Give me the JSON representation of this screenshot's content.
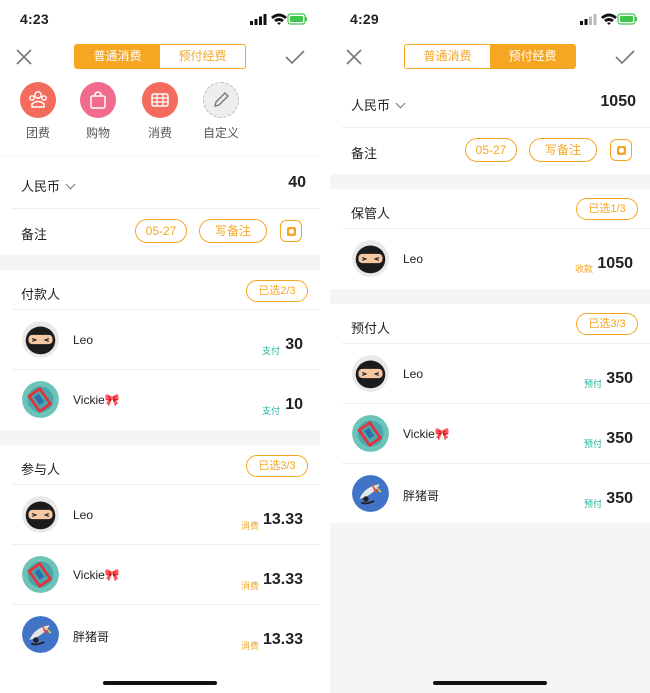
{
  "left": {
    "status": {
      "time": "4:23"
    },
    "nav": {
      "tab_normal": "普通消费",
      "tab_prepaid": "预付经费",
      "active": "normal"
    },
    "categories": [
      {
        "label": "团费",
        "icon": "group-icon",
        "color": "#f46a5c"
      },
      {
        "label": "购物",
        "icon": "shopping-bag-icon",
        "color": "#f06b8d"
      },
      {
        "label": "消费",
        "icon": "receipt-icon",
        "color": "#f46a5c"
      },
      {
        "label": "自定义",
        "icon": "pencil-icon",
        "color": "#eeeeee"
      }
    ],
    "currency": "人民币",
    "amount": "40",
    "note": {
      "label": "备注",
      "date": "05-27",
      "write": "写备注"
    },
    "payers": {
      "title": "付款人",
      "badge": "已选2/3",
      "rows": [
        {
          "name": "Leo",
          "tag": "支付",
          "value": "30"
        },
        {
          "name": "Vickie🎀",
          "tag": "支付",
          "value": "10"
        }
      ]
    },
    "participants": {
      "title": "参与人",
      "badge": "已选3/3",
      "rows": [
        {
          "name": "Leo",
          "tag": "消费",
          "value": "13.33"
        },
        {
          "name": "Vickie🎀",
          "tag": "消费",
          "value": "13.33"
        },
        {
          "name": "胖猪哥",
          "tag": "消费",
          "value": "13.33"
        }
      ]
    }
  },
  "right": {
    "status": {
      "time": "4:29"
    },
    "nav": {
      "tab_normal": "普通消费",
      "tab_prepaid": "预付经费",
      "active": "prepaid"
    },
    "currency": "人民币",
    "amount": "1050",
    "note": {
      "label": "备注",
      "date": "05-27",
      "write": "写备注"
    },
    "keeper": {
      "title": "保管人",
      "badge": "已选1/3",
      "rows": [
        {
          "name": "Leo",
          "tag": "收款",
          "value": "1050"
        }
      ]
    },
    "prepayers": {
      "title": "预付人",
      "badge": "已选3/3",
      "rows": [
        {
          "name": "Leo",
          "tag": "预付",
          "value": "350"
        },
        {
          "name": "Vickie🎀",
          "tag": "预付",
          "value": "350"
        },
        {
          "name": "胖猪哥",
          "tag": "预付",
          "value": "350"
        }
      ]
    }
  }
}
